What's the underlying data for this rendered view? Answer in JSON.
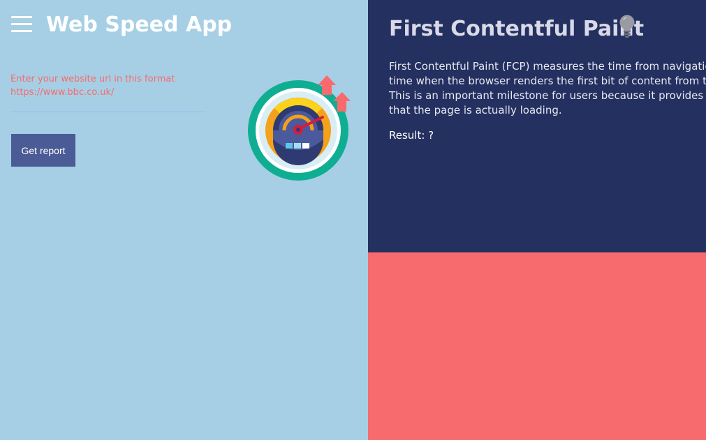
{
  "app": {
    "title": "Web Speed App"
  },
  "form": {
    "hint_line1": "Enter your website url in this format",
    "hint_line2": "https://www.bbc.co.uk/",
    "url_value": "",
    "button_label": "Get report"
  },
  "metric": {
    "title": "First Contentful Paint",
    "description_lines": [
      "First Contentful Paint (FCP) measures the time from navigation to the",
      "time when the browser renders the first bit of content from the DOM.",
      "This is an important milestone for users because it provides feedback",
      "that the page is actually loading."
    ],
    "result": "Result: ?"
  },
  "icons": {
    "menu": "hamburger-menu-icon",
    "gauge": "speedometer-icon",
    "bulb": "lightbulb-icon"
  },
  "colors": {
    "left_background": "#a6cfe5",
    "right_top_background": "#243060",
    "right_bottom_background": "#f76b6e",
    "accent_text": "#f76b6e",
    "button_background": "#4b5b96"
  }
}
